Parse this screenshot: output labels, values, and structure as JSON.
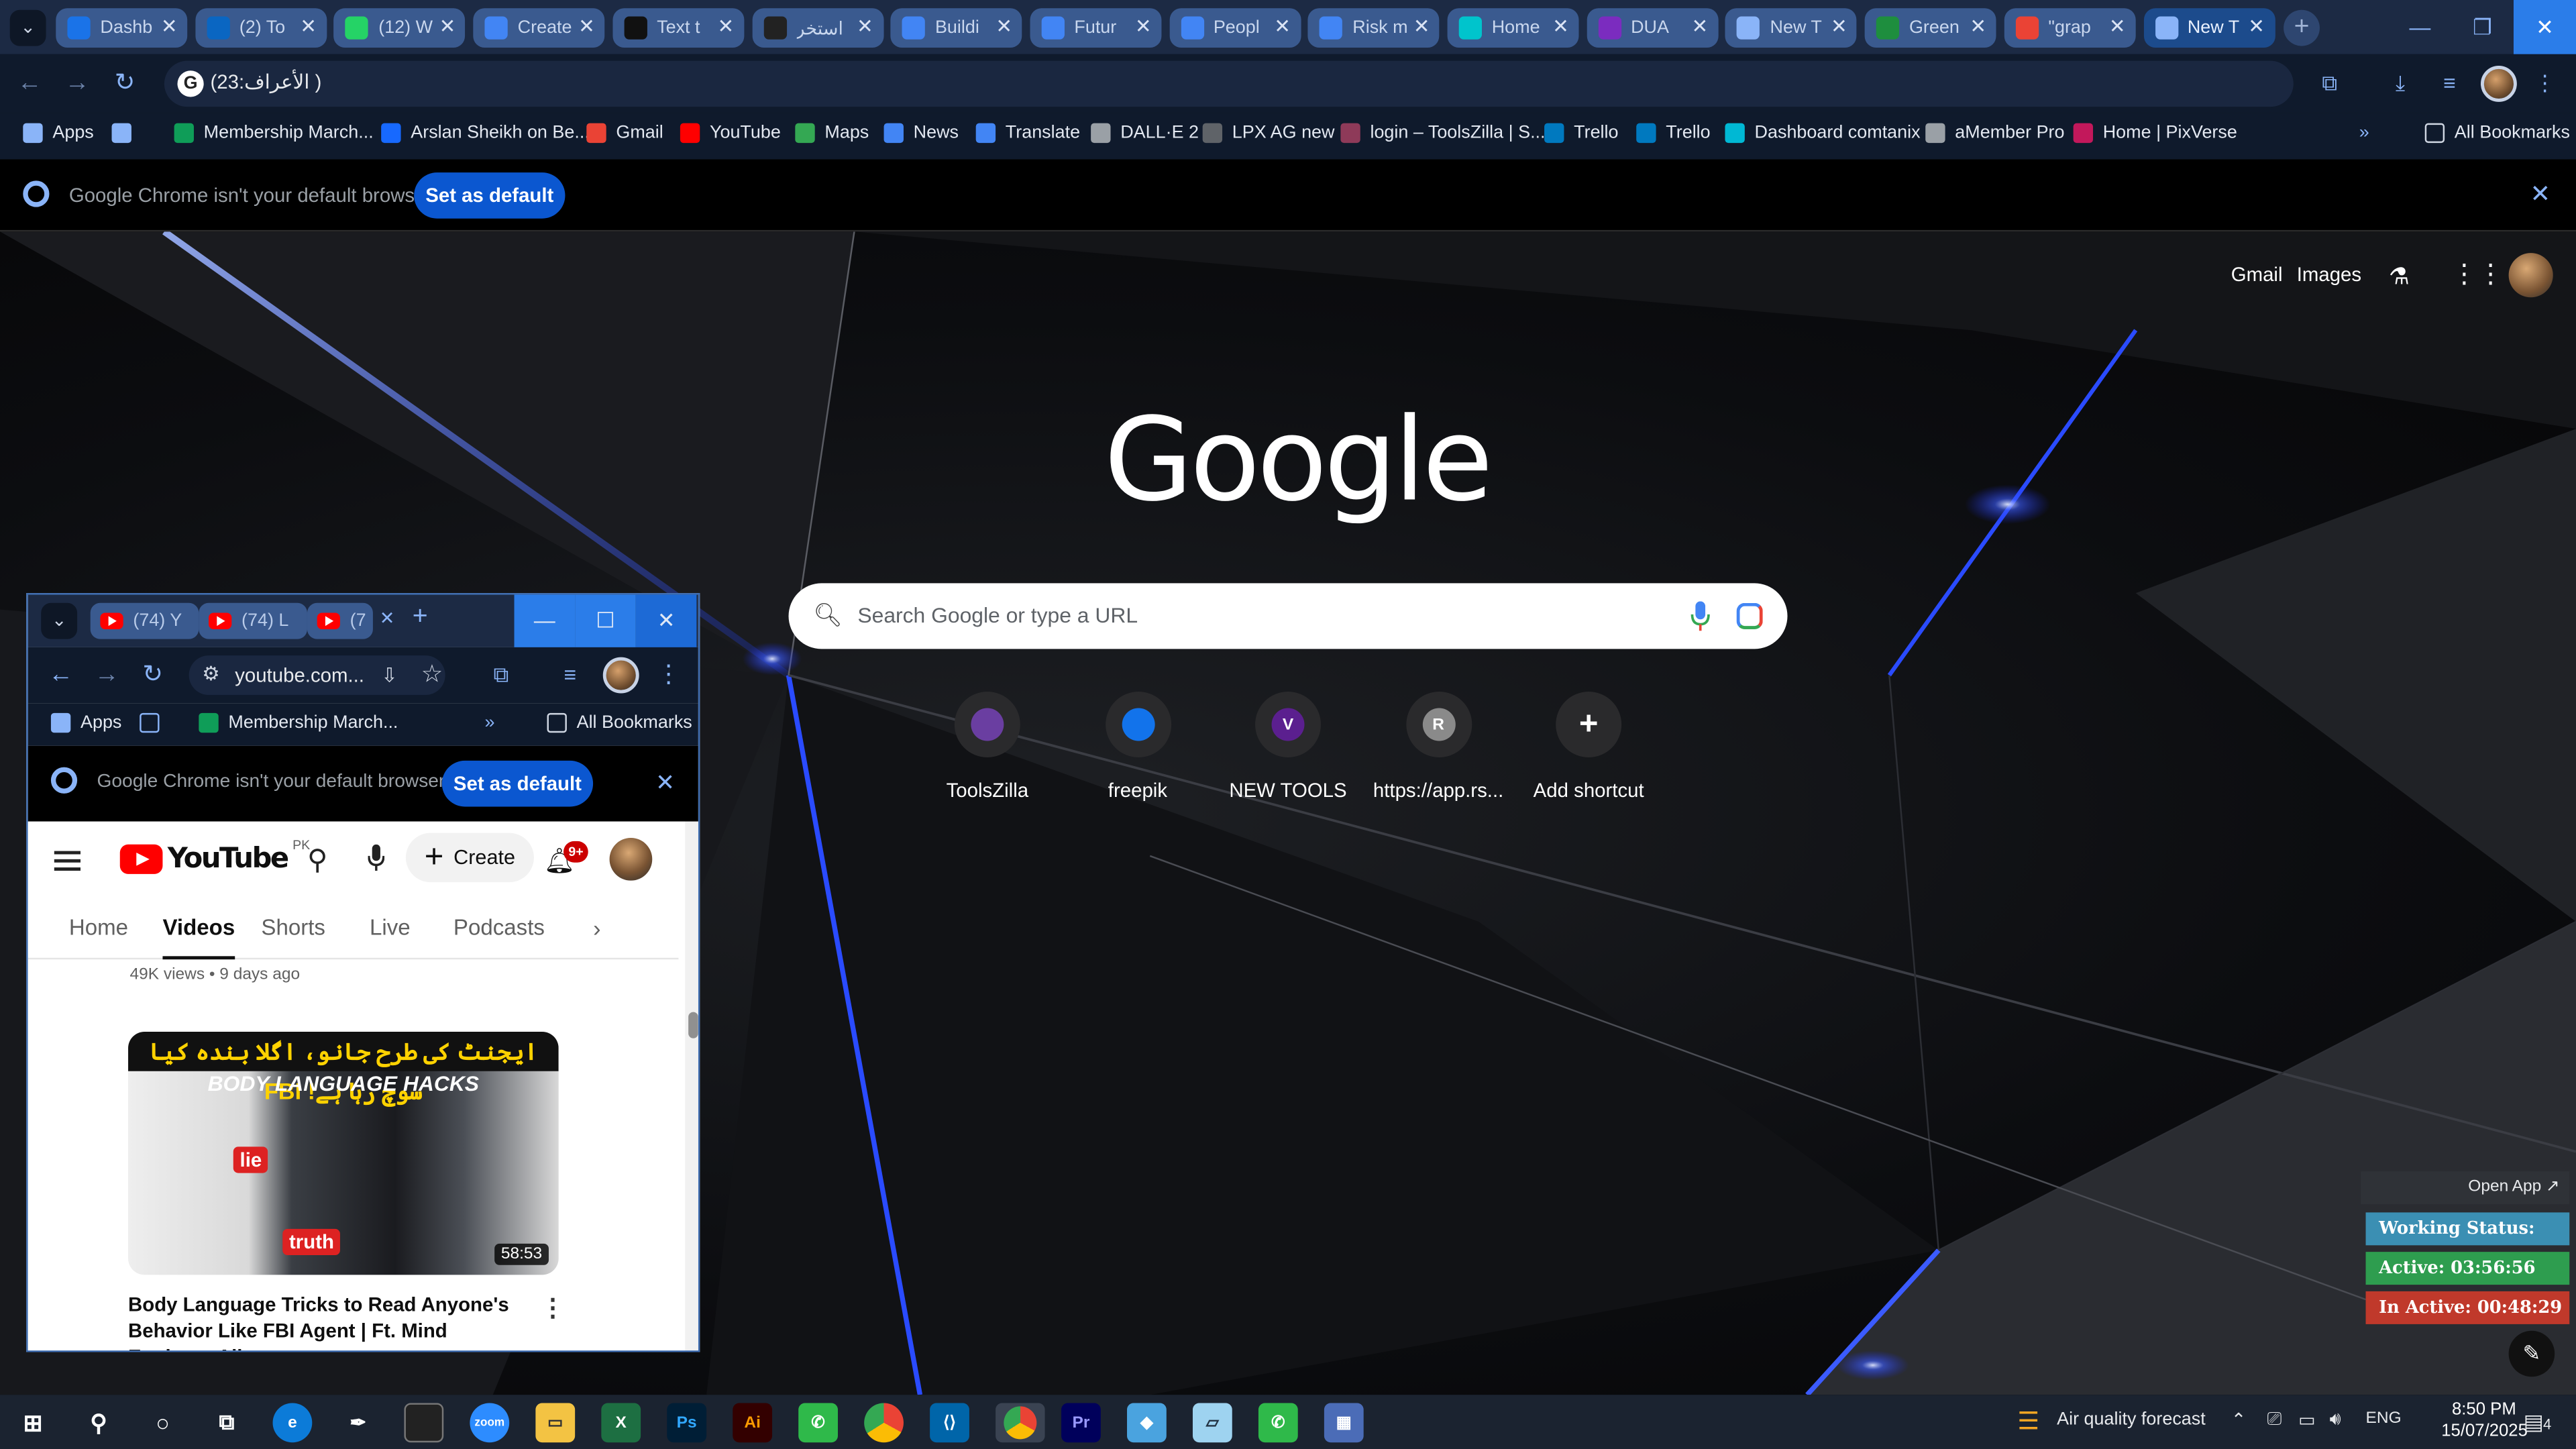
{
  "browser": {
    "tabs": [
      {
        "title": "Dashb",
        "icon": "chrome-icon",
        "color": "#1a73e8"
      },
      {
        "title": "(2) To",
        "icon": "linkedin-icon",
        "color": "#0a66c2"
      },
      {
        "title": "(12) W",
        "icon": "whatsapp-icon",
        "color": "#25d366"
      },
      {
        "title": "Create",
        "icon": "docs-icon",
        "color": "#4285f4"
      },
      {
        "title": "Text t",
        "icon": "text-icon",
        "color": "#111111"
      },
      {
        "title": "استخر",
        "icon": "openai-icon",
        "color": "#222222"
      },
      {
        "title": "Buildi",
        "icon": "docs-icon",
        "color": "#4285f4"
      },
      {
        "title": "Futur",
        "icon": "docs-icon",
        "color": "#4285f4"
      },
      {
        "title": "Peopl",
        "icon": "docs-icon",
        "color": "#4285f4"
      },
      {
        "title": "Risk m",
        "icon": "docs-icon",
        "color": "#4285f4"
      },
      {
        "title": "Home",
        "icon": "canva-icon",
        "color": "#00c4cc"
      },
      {
        "title": "DUA",
        "icon": "play-icon",
        "color": "#7b2cbf"
      },
      {
        "title": "New T",
        "icon": "chrome-icon",
        "color": "#8ab4f8"
      },
      {
        "title": "Green",
        "icon": "feather-icon",
        "color": "#1e8e3e"
      },
      {
        "title": "\"grap",
        "icon": "gmail-icon",
        "color": "#ea4335"
      },
      {
        "title": "New T",
        "icon": "chrome-icon",
        "color": "#8ab4f8"
      }
    ],
    "address": "(23:الأعراف )",
    "bookmarks": [
      {
        "label": "Apps",
        "color": "#8ab4f8"
      },
      {
        "label": "",
        "color": "#8ab4f8"
      },
      {
        "label": "Membership March...",
        "color": "#0f9d58"
      },
      {
        "label": "Arslan Sheikh on Be...",
        "color": "#1769ff"
      },
      {
        "label": "Gmail",
        "color": "#ea4335"
      },
      {
        "label": "YouTube",
        "color": "#ff0000"
      },
      {
        "label": "Maps",
        "color": "#34a853"
      },
      {
        "label": "News",
        "color": "#4285f4"
      },
      {
        "label": "Translate",
        "color": "#4285f4"
      },
      {
        "label": "DALL·E 2",
        "color": "#9aa0a6"
      },
      {
        "label": "LPX AG new",
        "color": "#5f6368"
      },
      {
        "label": "login – ToolsZilla | S...",
        "color": "#8e3a59"
      },
      {
        "label": "Trello",
        "color": "#0079bf"
      },
      {
        "label": "Trello",
        "color": "#0079bf"
      },
      {
        "label": "Dashboard comtanix",
        "color": "#00b8d4"
      },
      {
        "label": "aMember Pro",
        "color": "#9aa0a6"
      },
      {
        "label": "Home | PixVerse",
        "color": "#c2185b"
      }
    ],
    "all_bookmarks": "All Bookmarks",
    "infobar": {
      "message": "Google Chrome isn't your default browser",
      "button": "Set as default"
    }
  },
  "ntp": {
    "links": {
      "gmail": "Gmail",
      "images": "Images"
    },
    "logo": "Google",
    "search_placeholder": "Search Google or type a URL",
    "shortcuts": [
      {
        "label": "ToolsZilla",
        "initial": "",
        "color": "#6a3ea1"
      },
      {
        "label": "freepik",
        "initial": "",
        "color": "#1273eb"
      },
      {
        "label": "NEW TOOLS",
        "initial": "V",
        "color": "#5b1f8f"
      },
      {
        "label": "https://app.rs...",
        "initial": "R",
        "color": "#8a8a8a"
      },
      {
        "label": "Add shortcut",
        "initial": "+",
        "color": "#2a2a2c"
      }
    ]
  },
  "popup": {
    "tabs": [
      {
        "title": "(74) Y"
      },
      {
        "title": "(74) L"
      },
      {
        "title": "(7"
      }
    ],
    "address": "youtube.com...",
    "bookmarks": {
      "apps": "Apps",
      "membership": "Membership March...",
      "all": "All Bookmarks"
    },
    "infobar": {
      "message": "Google Chrome isn't your default browser",
      "button": "Set as default"
    },
    "youtube": {
      "logo_text": "YouTube",
      "country": "PK",
      "create_label": "Create",
      "notifications": "9+",
      "tabs": [
        "Home",
        "Videos",
        "Shorts",
        "Live",
        "Podcasts"
      ],
      "active_tab": "Videos",
      "prev_meta": "49K views • 9 days ago",
      "video": {
        "thumb_urdu": "ایجنٹ کی طرح جانو، اگلا بندہ کیا سوچ رہا ہے! FBI",
        "thumb_heading": "BODY LANGUAGE HACKS",
        "thumb_tag1": "lie",
        "thumb_tag2": "truth",
        "duration": "58:53",
        "title": "Body Language Tricks to Read Anyone's Behavior Like FBI Agent | Ft. Mind Engineer Ali"
      }
    }
  },
  "widget": {
    "open_app": "Open App ↗",
    "working_status": "Working Status: Active",
    "active": "Active: 03:56:56",
    "inactive": "In Active: 00:48:29",
    "colors": {
      "status": "#3b8fb3",
      "active": "#2e9d4f",
      "inactive": "#c0392b"
    }
  },
  "taskbar": {
    "weather": "Air quality forecast",
    "language": "ENG",
    "time": "8:50 PM",
    "date": "15/07/2025",
    "notification_count": "4"
  }
}
